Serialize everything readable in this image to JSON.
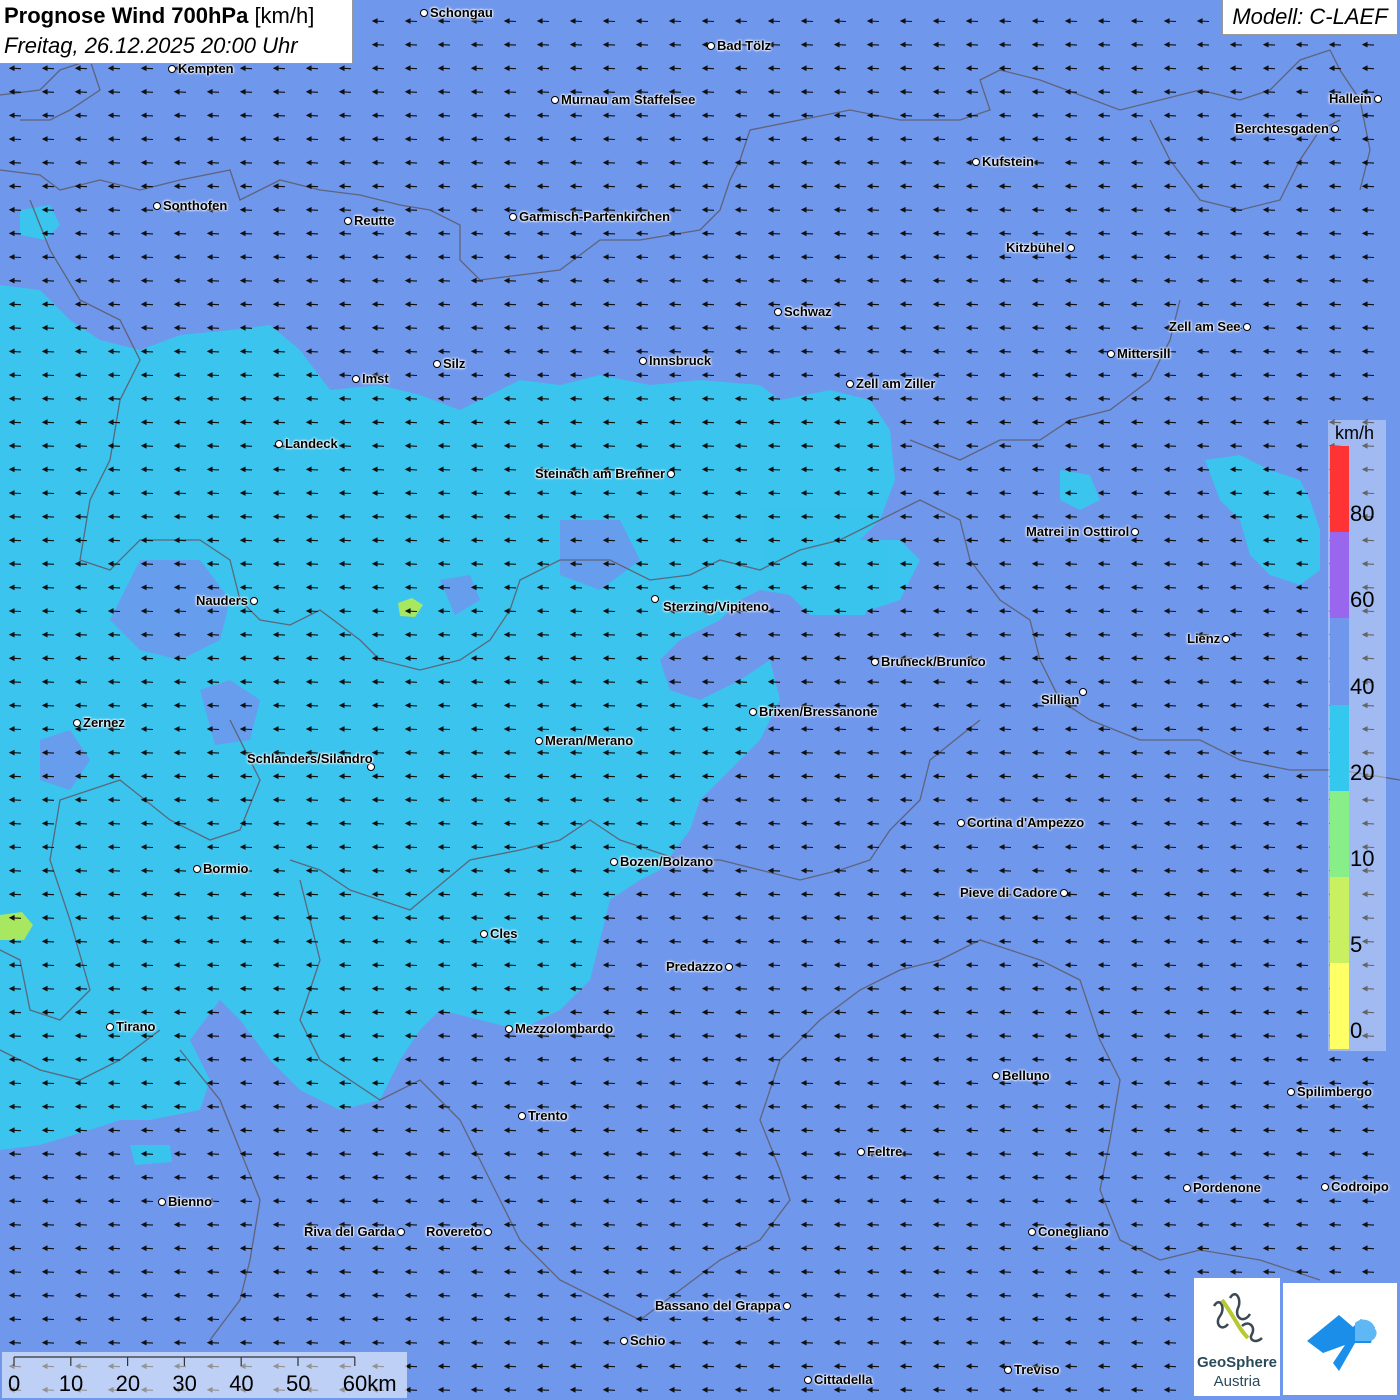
{
  "header": {
    "title": "Prognose Wind 700hPa",
    "unit": "[km/h]",
    "datetime": "Freitag, 26.12.2025 20:00 Uhr",
    "model": "Modell: C-LAEF"
  },
  "cities": [
    {
      "name": "Schongau"
    },
    {
      "name": "Bad Tölz"
    },
    {
      "name": "Kempten"
    },
    {
      "name": "Murnau am Staffelsee"
    },
    {
      "name": "Hallein"
    },
    {
      "name": "Berchtesgaden"
    },
    {
      "name": "Kufstein"
    },
    {
      "name": "Sonthofen"
    },
    {
      "name": "Reutte"
    },
    {
      "name": "Garmisch-Partenkirchen"
    },
    {
      "name": "Kitzbühel"
    },
    {
      "name": "Schwaz"
    },
    {
      "name": "Zell am See"
    },
    {
      "name": "Mittersill"
    },
    {
      "name": "Silz"
    },
    {
      "name": "Innsbruck"
    },
    {
      "name": "Imst"
    },
    {
      "name": "Zell am Ziller"
    },
    {
      "name": "Landeck"
    },
    {
      "name": "Steinach am Brenner"
    },
    {
      "name": "Matrei in Osttirol"
    },
    {
      "name": "Nauders"
    },
    {
      "name": "Sterzing/Vipiteno"
    },
    {
      "name": "Lienz"
    },
    {
      "name": "Bruneck/Brunico"
    },
    {
      "name": "Sillian"
    },
    {
      "name": "Zernez"
    },
    {
      "name": "Brixen/Bressanone"
    },
    {
      "name": "Meran/Merano"
    },
    {
      "name": "Schlanders/Silandro"
    },
    {
      "name": "Cortina d'Ampezzo"
    },
    {
      "name": "Bozen/Bolzano"
    },
    {
      "name": "Bormio"
    },
    {
      "name": "Pieve di Cadore"
    },
    {
      "name": "Cles"
    },
    {
      "name": "Predazzo"
    },
    {
      "name": "Tirano"
    },
    {
      "name": "Mezzolombardo"
    },
    {
      "name": "Belluno"
    },
    {
      "name": "Spilimbergo"
    },
    {
      "name": "Trento"
    },
    {
      "name": "Feltre"
    },
    {
      "name": "Pordenone"
    },
    {
      "name": "Codroipo"
    },
    {
      "name": "Bienno"
    },
    {
      "name": "Riva del Garda"
    },
    {
      "name": "Rovereto"
    },
    {
      "name": "Conegliano"
    },
    {
      "name": "Bassano del Grappa"
    },
    {
      "name": "Schio"
    },
    {
      "name": "Treviso"
    },
    {
      "name": "Cittadella"
    }
  ],
  "legend": {
    "unit": "km/h",
    "classes": [
      {
        "label": "80",
        "color": "#ff3333"
      },
      {
        "label": "60",
        "color": "#9966ee"
      },
      {
        "label": "40",
        "color": "#6f97ec"
      },
      {
        "label": "20",
        "color": "#35c8ee"
      },
      {
        "label": "10",
        "color": "#88ee88"
      },
      {
        "label": "5",
        "color": "#c8f060"
      },
      {
        "label": "0",
        "color": "#ffff66"
      }
    ]
  },
  "scale": {
    "ticks": [
      "0",
      "10",
      "20",
      "30",
      "40",
      "50",
      "60km"
    ]
  },
  "colors": {
    "background": "#6f97ec",
    "cyan_zone": "#35c8ee",
    "green_spot": "#a8e860",
    "border": "#6a6a7a",
    "arrow": "#111111"
  },
  "logos": {
    "geosphere_name": "GeoSphere",
    "geosphere_country": "Austria"
  }
}
